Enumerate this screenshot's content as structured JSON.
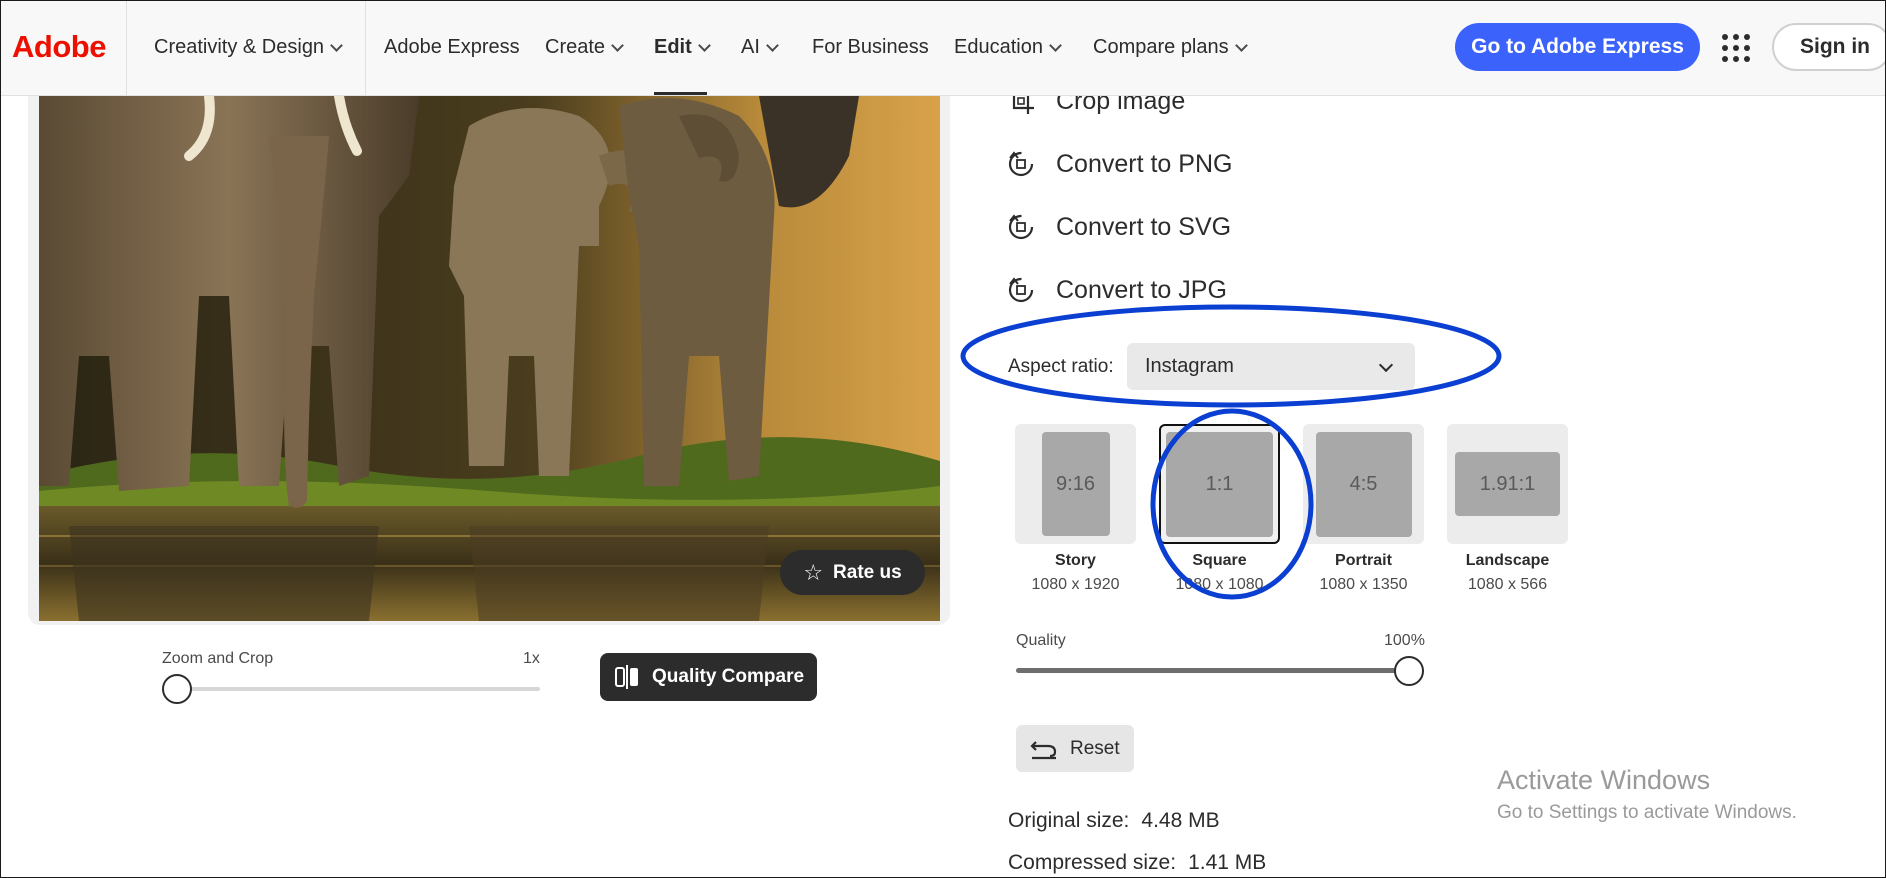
{
  "nav": {
    "logo": "Adobe",
    "items": [
      {
        "label": "Creativity & Design",
        "dropdown": true
      },
      {
        "label": "Adobe Express",
        "dropdown": false
      },
      {
        "label": "Create",
        "dropdown": true
      },
      {
        "label": "Edit",
        "dropdown": true,
        "active": true
      },
      {
        "label": "AI",
        "dropdown": true
      },
      {
        "label": "For Business",
        "dropdown": false
      },
      {
        "label": "Education",
        "dropdown": true
      },
      {
        "label": "Compare plans",
        "dropdown": true
      }
    ],
    "cta": "Go to Adobe Express",
    "apps_icon": "app-grid-icon",
    "sign_in": "Sign in"
  },
  "preview": {
    "rate_us": "Rate us",
    "zoom_label": "Zoom and Crop",
    "zoom_value": "1x",
    "zoom_level": 0,
    "quality_compare": "Quality Compare"
  },
  "options": [
    {
      "label": "Crop image",
      "icon": "crop-icon"
    },
    {
      "label": "Convert to PNG",
      "icon": "convert-icon"
    },
    {
      "label": "Convert to SVG",
      "icon": "convert-icon"
    },
    {
      "label": "Convert to JPG",
      "icon": "convert-icon"
    }
  ],
  "aspect": {
    "label": "Aspect ratio:",
    "selected": "Instagram",
    "tiles": [
      {
        "ratio": "9:16",
        "name": "Story",
        "dims": "1080 x 1920",
        "selected": false
      },
      {
        "ratio": "1:1",
        "name": "Square",
        "dims": "1080 x 1080",
        "selected": true
      },
      {
        "ratio": "4:5",
        "name": "Portrait",
        "dims": "1080 x 1350",
        "selected": false
      },
      {
        "ratio": "1.91:1",
        "name": "Landscape",
        "dims": "1080 x 566",
        "selected": false
      }
    ]
  },
  "quality": {
    "label": "Quality",
    "value": "100%",
    "level": 1.0
  },
  "reset": "Reset",
  "sizes": {
    "original_label": "Original size:",
    "original_value": "4.48 MB",
    "compressed_label": "Compressed size:",
    "compressed_value": "1.41 MB"
  },
  "watermark": {
    "line1": "Activate Windows",
    "line2": "Go to Settings to activate Windows."
  },
  "colors": {
    "brand_red": "#eb1000",
    "cta_blue": "#3b63fb",
    "annotation_blue": "#0a3fd1"
  }
}
